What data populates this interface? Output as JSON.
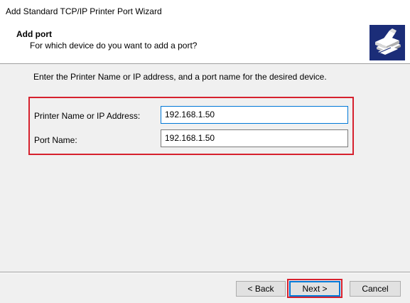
{
  "window": {
    "title": "Add Standard TCP/IP Printer Port Wizard"
  },
  "header": {
    "title": "Add port",
    "subtitle": "For which device do you want to add a port?",
    "icon": "printer-icon"
  },
  "main": {
    "instruction": "Enter the Printer Name or IP address, and a port name for the desired device.",
    "fields": [
      {
        "label": "Printer Name or IP Address:",
        "value": "192.168.1.50"
      },
      {
        "label": "Port Name:",
        "value": "192.168.1.50"
      }
    ]
  },
  "buttons": {
    "back": "< Back",
    "next": "Next >",
    "cancel": "Cancel"
  },
  "colors": {
    "highlight": "#d6212e",
    "focus": "#0078d7",
    "icon_bg": "#1b2d78"
  }
}
